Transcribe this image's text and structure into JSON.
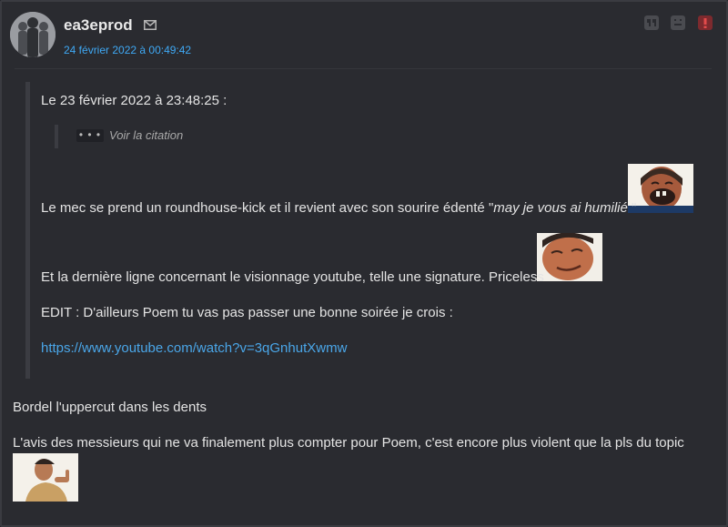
{
  "post": {
    "author": "ea3eprod",
    "date": "24 février 2022 à 00:49:42",
    "quote": {
      "header": "Le 23 février 2022 à 23:48:25 :",
      "nested": {
        "ellipsis": "• • •",
        "label": "Voir la citation"
      },
      "line1_before": "Le mec se prend un roundhouse-kick et il revient avec son sourire édenté \"",
      "line1_italic": "may je vous ai humilié",
      "line1_after": " \"",
      "line2": "Et la dernière ligne concernant le visionnage youtube, telle une signature. Priceless",
      "line3": "EDIT : D'ailleurs Poem tu vas pas passer une bonne soirée je crois :",
      "link": "https://www.youtube.com/watch?v=3qGnhutXwmw"
    },
    "reply_line1": "Bordel l'uppercut dans les dents",
    "reply_line2": "L'avis des messieurs qui ne va finalement plus compter pour Poem, c'est encore plus violent que la pls du topic"
  },
  "actions": {
    "quote_icon": "quote-icon",
    "sad_icon": "sad-face-icon",
    "report_icon": "report-icon",
    "mail_icon": "mail-icon"
  },
  "colors": {
    "background": "#2a2b30",
    "date": "#3fa9f5",
    "link": "#4aa6e8",
    "report": "#e34b4b"
  }
}
